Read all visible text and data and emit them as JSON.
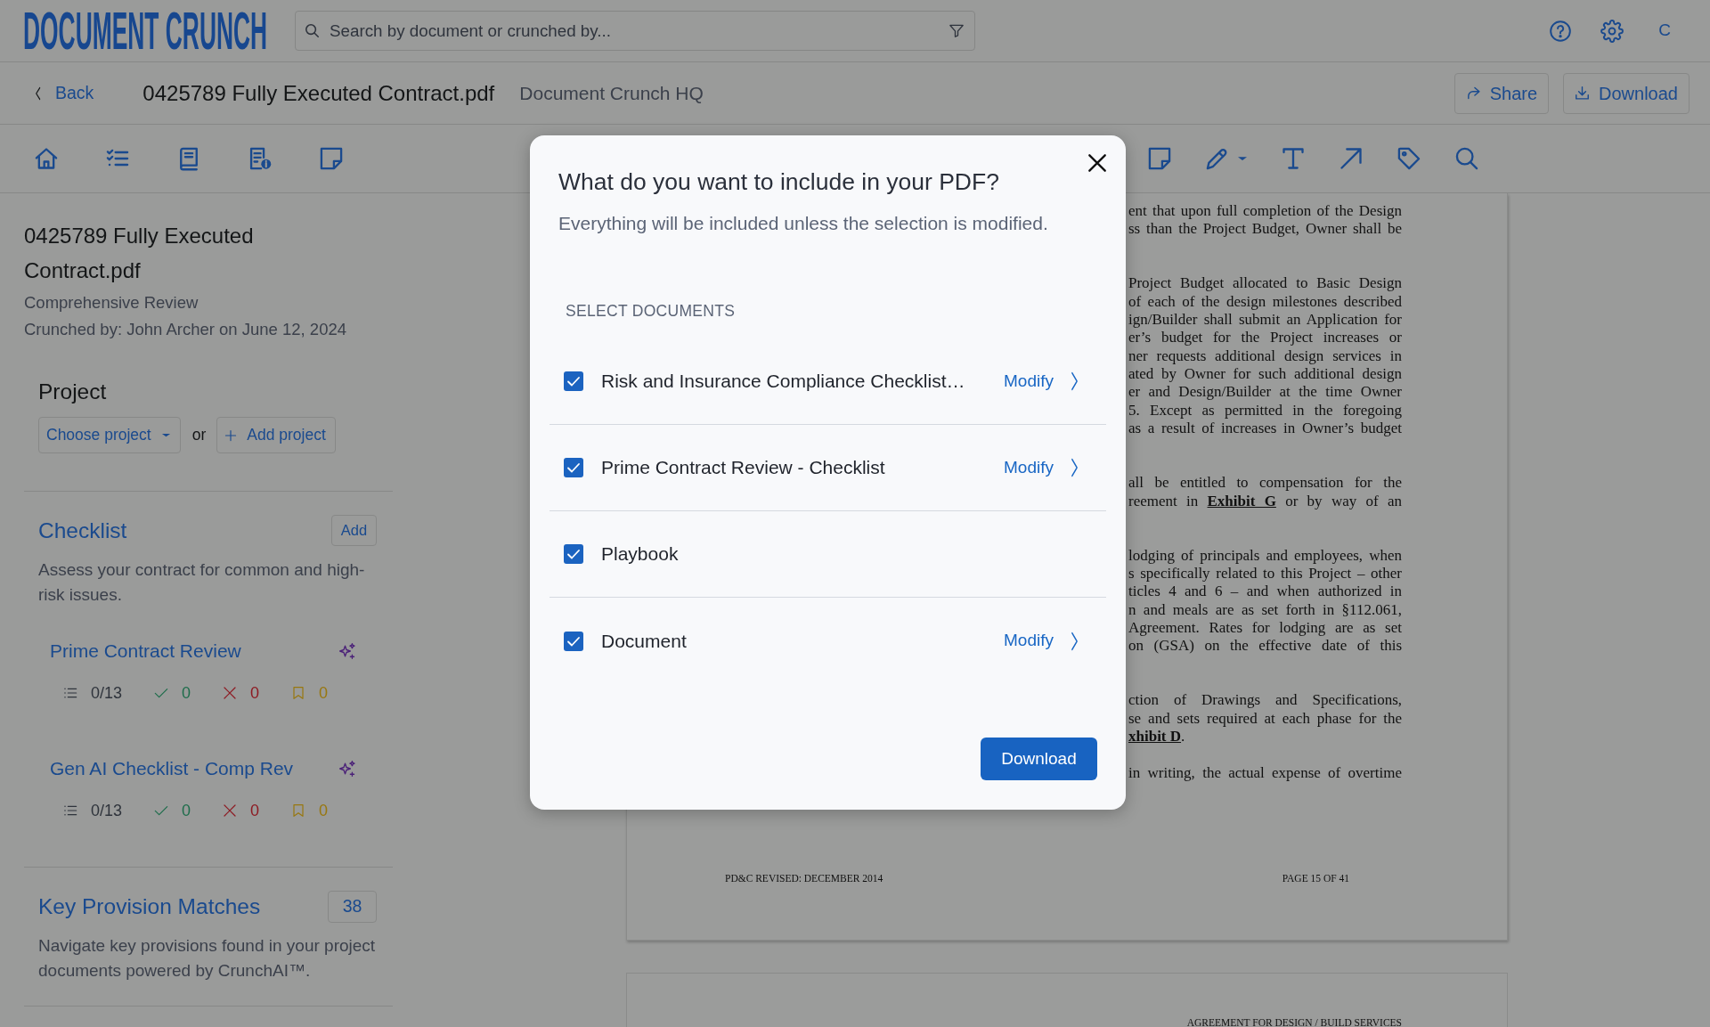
{
  "header": {
    "logo": "DOCUMENT CRUNCH",
    "search": {
      "placeholder": "Search by document or crunched by..."
    },
    "user_initial": "C"
  },
  "doc_bar": {
    "back": "Back",
    "title": "0425789 Fully Executed Contract.pdf",
    "workspace": "Document Crunch HQ",
    "actions": [
      {
        "kind": "share",
        "label": "Share"
      },
      {
        "kind": "download",
        "label": "Download"
      }
    ]
  },
  "sidebar": {
    "title": "0425789 Fully Executed Contract.pdf",
    "review_type": "Comprehensive Review",
    "crunched_by": "Crunched by: John Archer on June 12, 2024",
    "project": {
      "heading": "Project",
      "dropdown": "Choose project",
      "separator": "or",
      "add_button": "Add project"
    },
    "checklist": {
      "heading": "Checklist",
      "add_button": "Add",
      "description": "Assess your contract for common and high-risk issues.",
      "items": [
        {
          "name": "Prime Contract Review",
          "stats": [
            {
              "kind": "progress",
              "value": "0/13"
            },
            {
              "kind": "passed",
              "value": "0"
            },
            {
              "kind": "failed",
              "value": "0"
            },
            {
              "kind": "flagged",
              "value": "0"
            }
          ]
        },
        {
          "name": "Gen AI Checklist - Comp Rev",
          "stats": [
            {
              "kind": "progress",
              "value": "0/13"
            },
            {
              "kind": "passed",
              "value": "0"
            },
            {
              "kind": "failed",
              "value": "0"
            },
            {
              "kind": "flagged",
              "value": "0"
            }
          ]
        }
      ]
    },
    "key_provisions": {
      "heading": "Key Provision Matches",
      "count": "38",
      "description": "Navigate key provisions found in your project documents powered by CrunchAI™."
    }
  },
  "document": {
    "paragraphs": [
      {
        "lines": [
          "ent that upon full completion of the Design",
          "ss than the Project Budget, Owner shall be"
        ],
        "ends_here": false
      },
      {
        "lines": [
          "Project Budget allocated to Basic Design",
          "of each of the design milestones described",
          "ign/Builder shall submit an Application for",
          "er’s budget for the Project increases or",
          "ner requests additional design services in",
          "ated by Owner for such additional design",
          "er and Design/Builder at the time Owner",
          "5. Except as permitted in the foregoing",
          "as a result of increases in Owner’s budget"
        ],
        "ends_here": false
      },
      {
        "lines": [
          "all be entitled to compensation for the",
          "reement in **Exhibit G** or by way of an"
        ],
        "ends_here": false
      },
      {
        "lines": [
          "lodging of principals and employees, when",
          "s specifically related to this Project – other",
          "ticles 4 and 6 – and when authorized in",
          "n and meals are as set forth in §112.061,",
          "Agreement. Rates for lodging are as set",
          "on (GSA) on the effective date of this"
        ],
        "ends_here": false
      },
      {
        "lines": [
          "ction of Drawings and Specifications,",
          "se and sets required at each phase for the",
          "**xhibit D**."
        ],
        "ends_here": true
      },
      {
        "lines": [
          "in writing, the actual expense of overtime"
        ],
        "ends_here": false
      }
    ],
    "footer_left": "PD&C REVISED: DECEMBER 2014",
    "footer_right": "PAGE 15 OF 41",
    "next_page_header": "AGREEMENT FOR DESIGN / BUILD SERVICES"
  },
  "dialog": {
    "title": "What do you want to include in your PDF?",
    "subtitle": "Everything will be included unless the selection is modified.",
    "section_label": "SELECT DOCUMENTS",
    "documents": [
      {
        "name": "Risk and Insurance Compliance Checklist…",
        "checked": true,
        "action": "Modify"
      },
      {
        "name": "Prime Contract Review - Checklist",
        "checked": true,
        "action": "Modify"
      },
      {
        "name": "Playbook",
        "checked": true
      },
      {
        "name": "Document",
        "checked": true,
        "action": "Modify"
      }
    ],
    "button": "Download"
  }
}
